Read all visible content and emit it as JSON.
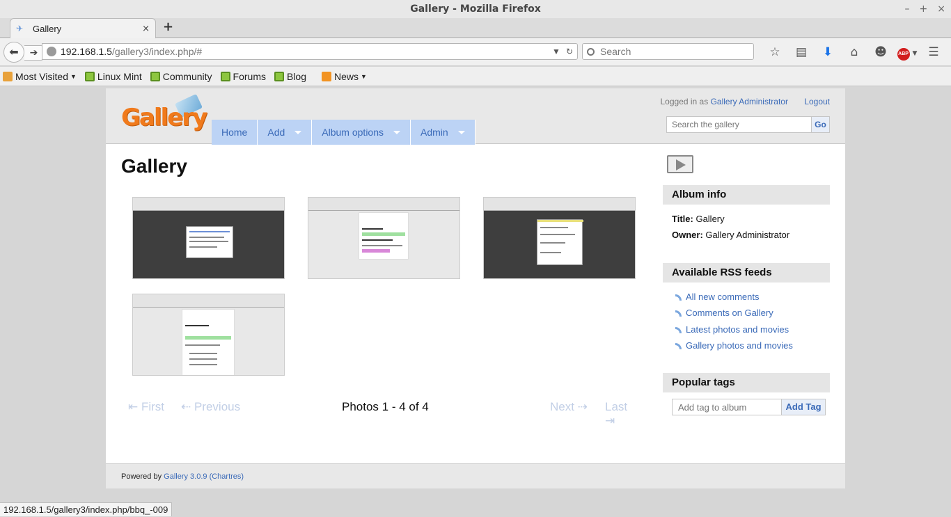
{
  "window": {
    "title": "Gallery - Mozilla Firefox",
    "controls": [
      "–",
      "+",
      "×"
    ]
  },
  "tab": {
    "title": "Gallery",
    "close": "×",
    "newtab": "+"
  },
  "nav": {
    "url_host": "192.168.1.5",
    "url_path": "/gallery3/index.php/#",
    "search_placeholder": "Search"
  },
  "bookmarks": [
    {
      "label": "Most Visited",
      "icon": "orange"
    },
    {
      "label": "Linux Mint",
      "icon": "green"
    },
    {
      "label": "Community",
      "icon": "green"
    },
    {
      "label": "Forums",
      "icon": "green"
    },
    {
      "label": "Blog",
      "icon": "green"
    },
    {
      "label": "News",
      "icon": "rss"
    }
  ],
  "header": {
    "logo": "Gallery",
    "logged_in_prefix": "Logged in as",
    "user": "Gallery Administrator",
    "logout": "Logout",
    "search_placeholder": "Search the gallery",
    "go": "Go",
    "menu": [
      {
        "label": "Home",
        "dropdown": false
      },
      {
        "label": "Add",
        "dropdown": true
      },
      {
        "label": "Album options",
        "dropdown": true
      },
      {
        "label": "Admin",
        "dropdown": true
      }
    ]
  },
  "main": {
    "title": "Gallery",
    "pager": {
      "first": "⇤ First",
      "previous": "⇠ Previous",
      "count": "Photos 1 - 4 of 4",
      "next": "Next ⇢",
      "last": "Last ⇥"
    }
  },
  "sidebar": {
    "album_info": {
      "heading": "Album info",
      "title_label": "Title:",
      "title_value": "Gallery",
      "owner_label": "Owner:",
      "owner_value": "Gallery Administrator"
    },
    "rss": {
      "heading": "Available RSS feeds",
      "feeds": [
        "All new comments",
        "Comments on Gallery",
        "Latest photos and movies",
        "Gallery photos and movies"
      ]
    },
    "tags": {
      "heading": "Popular tags",
      "placeholder": "Add tag to album",
      "button": "Add Tag"
    }
  },
  "footer": {
    "prefix": "Powered by",
    "link": "Gallery 3.0.9 (Chartres)"
  },
  "status_url": "192.168.1.5/gallery3/index.php/bbq_-009"
}
